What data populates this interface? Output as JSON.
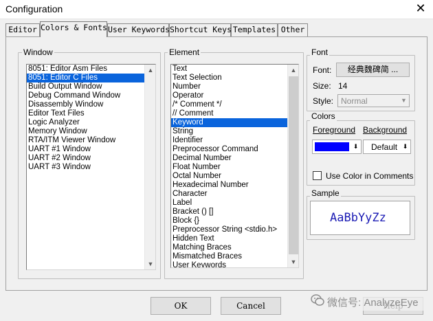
{
  "window": {
    "title": "Configuration",
    "close_glyph": "✕"
  },
  "tabs": [
    {
      "label": "Editor",
      "active": false
    },
    {
      "label": "Colors & Fonts",
      "active": true
    },
    {
      "label": "User Keywords",
      "active": false
    },
    {
      "label": "Shortcut Keys",
      "active": false
    },
    {
      "label": "Templates",
      "active": false
    },
    {
      "label": "Other",
      "active": false
    }
  ],
  "window_group": {
    "legend": "Window",
    "selected": "8051: Editor C Files",
    "items": [
      "8051: Editor Asm Files",
      "8051: Editor C Files",
      "Build Output Window",
      "Debug Command Window",
      "Disassembly Window",
      "Editor Text Files",
      "Logic Analyzer",
      "Memory Window",
      "RTA/ITM Viewer Window",
      "UART #1 Window",
      "UART #2 Window",
      "UART #3 Window"
    ]
  },
  "element_group": {
    "legend": "Element",
    "selected": "Keyword",
    "items": [
      "Text",
      "Text Selection",
      "Number",
      "Operator",
      "/* Comment */",
      "// Comment",
      "Keyword",
      "String",
      "Identifier",
      "Preprocessor Command",
      "Decimal Number",
      "Float Number",
      "Octal Number",
      "Hexadecimal Number",
      "Character",
      "Label",
      "Bracket () []",
      "Block {}",
      "Preprocessor String <stdio.h>",
      "Hidden Text",
      "Matching Braces",
      "Mismatched Braces",
      "User Keywords"
    ]
  },
  "font_group": {
    "legend": "Font",
    "font_label": "Font:",
    "font_button": "经典魏碑简 ...",
    "size_label": "Size:",
    "size_value": "14",
    "style_label": "Style:",
    "style_value": "Normal"
  },
  "colors_group": {
    "legend": "Colors",
    "foreground_label": "Foreground",
    "background_label": "Background",
    "foreground_color": "#0000ff",
    "background_value": "Default",
    "use_color_in_comments_label": "Use Color in Comments",
    "use_color_in_comments_checked": false
  },
  "sample_group": {
    "legend": "Sample",
    "text": "AaBbYyZz",
    "text_color": "#1a1ab4"
  },
  "buttons": {
    "ok": "OK",
    "cancel": "Cancel",
    "help": "Help"
  },
  "watermark": "微信号: AnalyzeEye"
}
